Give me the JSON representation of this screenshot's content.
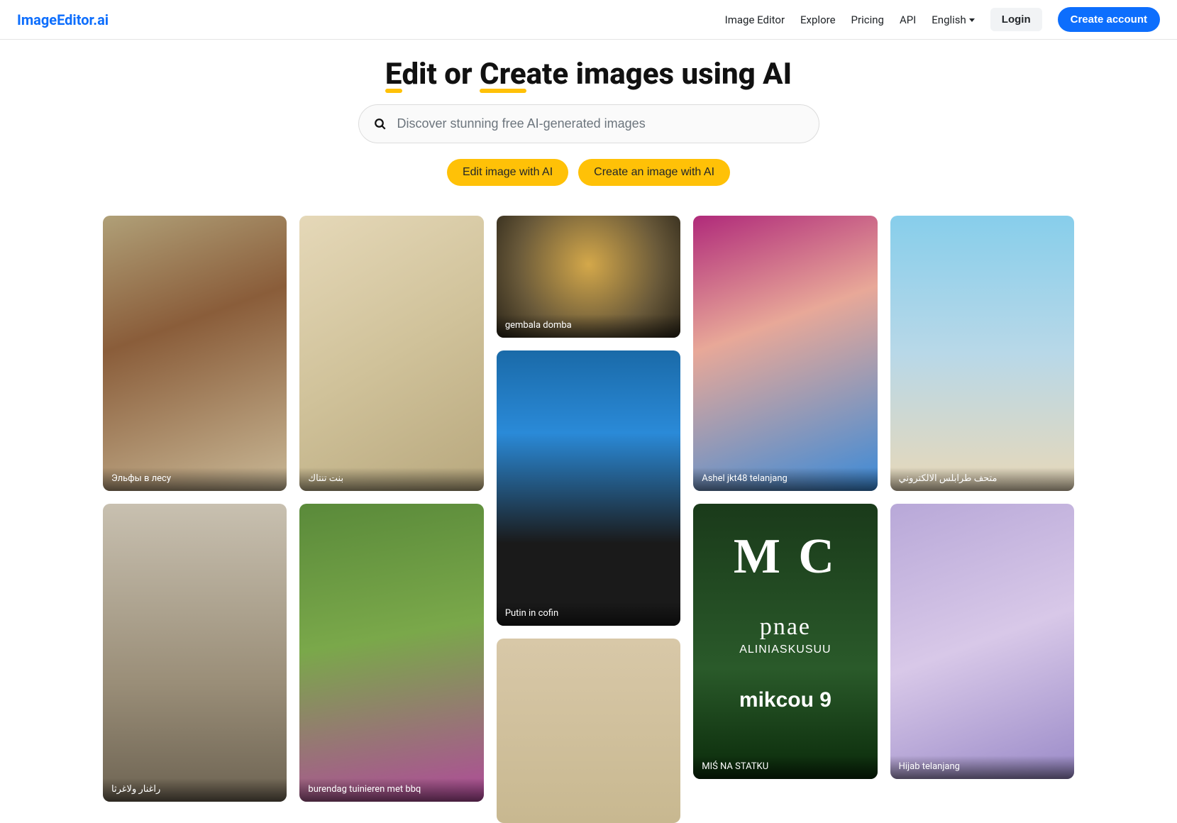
{
  "header": {
    "logo": "ImageEditor.ai",
    "nav": {
      "image_editor": "Image Editor",
      "explore": "Explore",
      "pricing": "Pricing",
      "api": "API",
      "language": "English"
    },
    "login": "Login",
    "create_account": "Create account"
  },
  "hero": {
    "title_pre": "E",
    "title_under1_rest": "dit",
    "title_or": " or ",
    "title_create_first": "Cre",
    "title_create_rest": "ate",
    "title_tail": " images using AI",
    "search_placeholder": "Discover stunning free AI-generated images",
    "edit_btn": "Edit image with AI",
    "create_btn": "Create an image with AI"
  },
  "gallery": {
    "col1": [
      {
        "caption": "Эльфы в лесу"
      },
      {
        "caption": "راغنار ولاغرثا"
      }
    ],
    "col2": [
      {
        "caption": "بنت تنتاك"
      },
      {
        "caption": "burendag tuinieren met bbq"
      }
    ],
    "col3": [
      {
        "caption": "gembala domba"
      },
      {
        "caption": "Putin in cofin"
      },
      {
        "caption": ""
      }
    ],
    "col4": [
      {
        "caption": "Ashel jkt48 telanjang"
      },
      {
        "caption": "MIŚ NA STATKU"
      }
    ],
    "col5": [
      {
        "caption": "متحف طرابلس الالكتروني"
      },
      {
        "caption": "Hijab telanjang"
      }
    ]
  },
  "mis_overlay": {
    "big": "M C",
    "med": "pnae",
    "sm": "ALINIASKUSUU",
    "bot": "mikcou 9"
  }
}
